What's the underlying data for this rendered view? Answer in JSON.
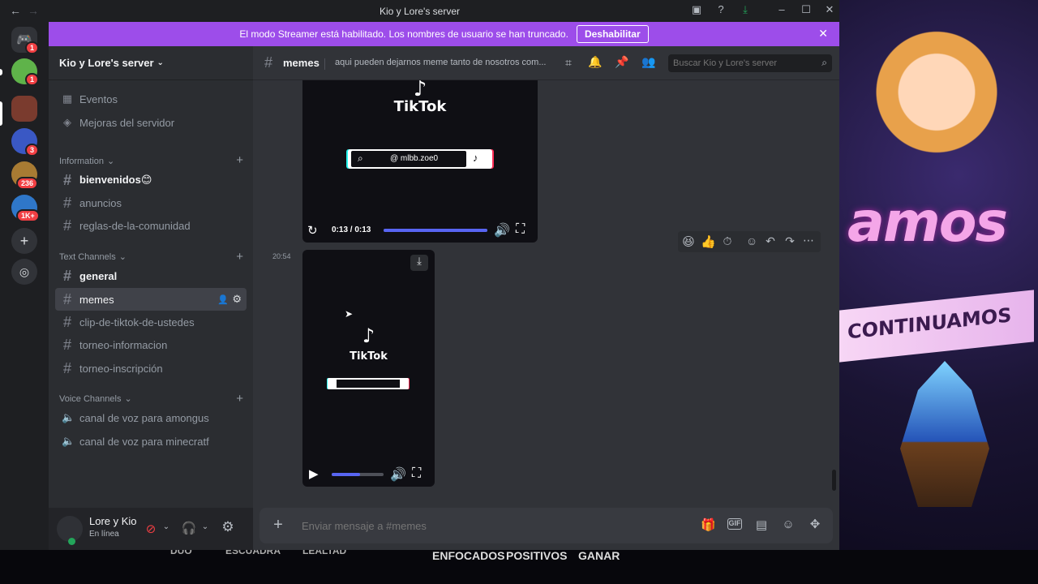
{
  "window": {
    "title": "Kio y Lore's server"
  },
  "streamer_banner": {
    "text": "El modo Streamer está habilitado. Los nombres de usuario se han truncado.",
    "button": "Deshabilitar"
  },
  "guilds": {
    "badges": [
      "1",
      "1",
      "3",
      "236",
      "1K+"
    ]
  },
  "server": {
    "name": "Kio y Lore's server"
  },
  "sidebar": {
    "top_items": [
      "Eventos",
      "Mejoras del servidor"
    ],
    "categories": {
      "information": {
        "label": "Information",
        "channels": [
          "bienvenidos😊",
          "anuncios",
          "reglas-de-la-comunidad"
        ]
      },
      "text": {
        "label": "Text Channels",
        "channels": [
          "general",
          "memes",
          "clip-de-tiktok-de-ustedes",
          "torneo-informacion",
          "torneo-inscripción"
        ]
      },
      "voice": {
        "label": "Voice Channels",
        "channels": [
          "canal de voz para amongus",
          "canal de voz para minecratf"
        ]
      }
    }
  },
  "user": {
    "name": "Lore y Kio",
    "status": "En línea"
  },
  "channel": {
    "name": "memes",
    "topic": "aqui pueden dejarnos meme tanto de nosotros com...",
    "search_placeholder": "Buscar Kio y Lore's server"
  },
  "messages": {
    "video1": {
      "logo": "TikTok",
      "handle": "@ mlbb.zoe0",
      "time": "0:13 / 0:13",
      "progress": 1.0
    },
    "video2": {
      "timestamp": "20:54",
      "logo": "TikTok",
      "progress": 0.55
    }
  },
  "composer": {
    "placeholder": "Enviar mensaje a #memes"
  },
  "background": {
    "banner_word": "amos",
    "ribbon": "CONTINUAMOS",
    "bottom_tabs": [
      "DUO",
      "ESCUADRA",
      "LEALTAD",
      "ENFOCADOS",
      "POSITIVOS",
      "GANAR"
    ]
  }
}
